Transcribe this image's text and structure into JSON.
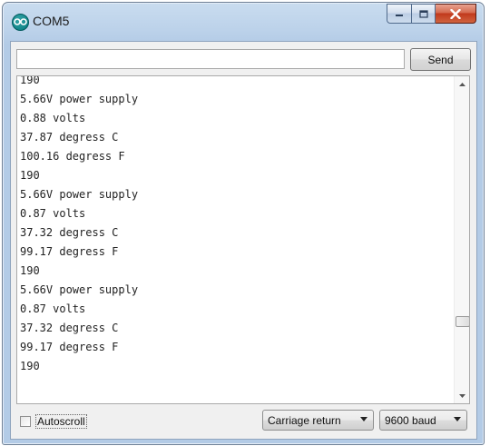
{
  "window": {
    "title": "COM5",
    "controls": [
      "minimize-icon",
      "maximize-icon",
      "close-icon"
    ]
  },
  "send_bar": {
    "input_value": "",
    "send_label": "Send"
  },
  "output": {
    "lines": [
      "190",
      "5.66V power supply",
      "0.88 volts",
      "37.87 degress C",
      "100.16 degress F",
      "190",
      "5.66V power supply",
      "0.87 volts",
      "37.32 degress C",
      "99.17 degress F",
      "190",
      "5.66V power supply",
      "0.87 volts",
      "37.32 degress C",
      "99.17 degress F",
      "190"
    ]
  },
  "footer": {
    "autoscroll_label": "Autoscroll",
    "autoscroll_checked": false,
    "line_ending": "Carriage return",
    "baud": "9600 baud"
  },
  "colors": {
    "titlebar": "#bcd2ea",
    "close_button": "#c1391c",
    "app_icon": "#00797d"
  }
}
